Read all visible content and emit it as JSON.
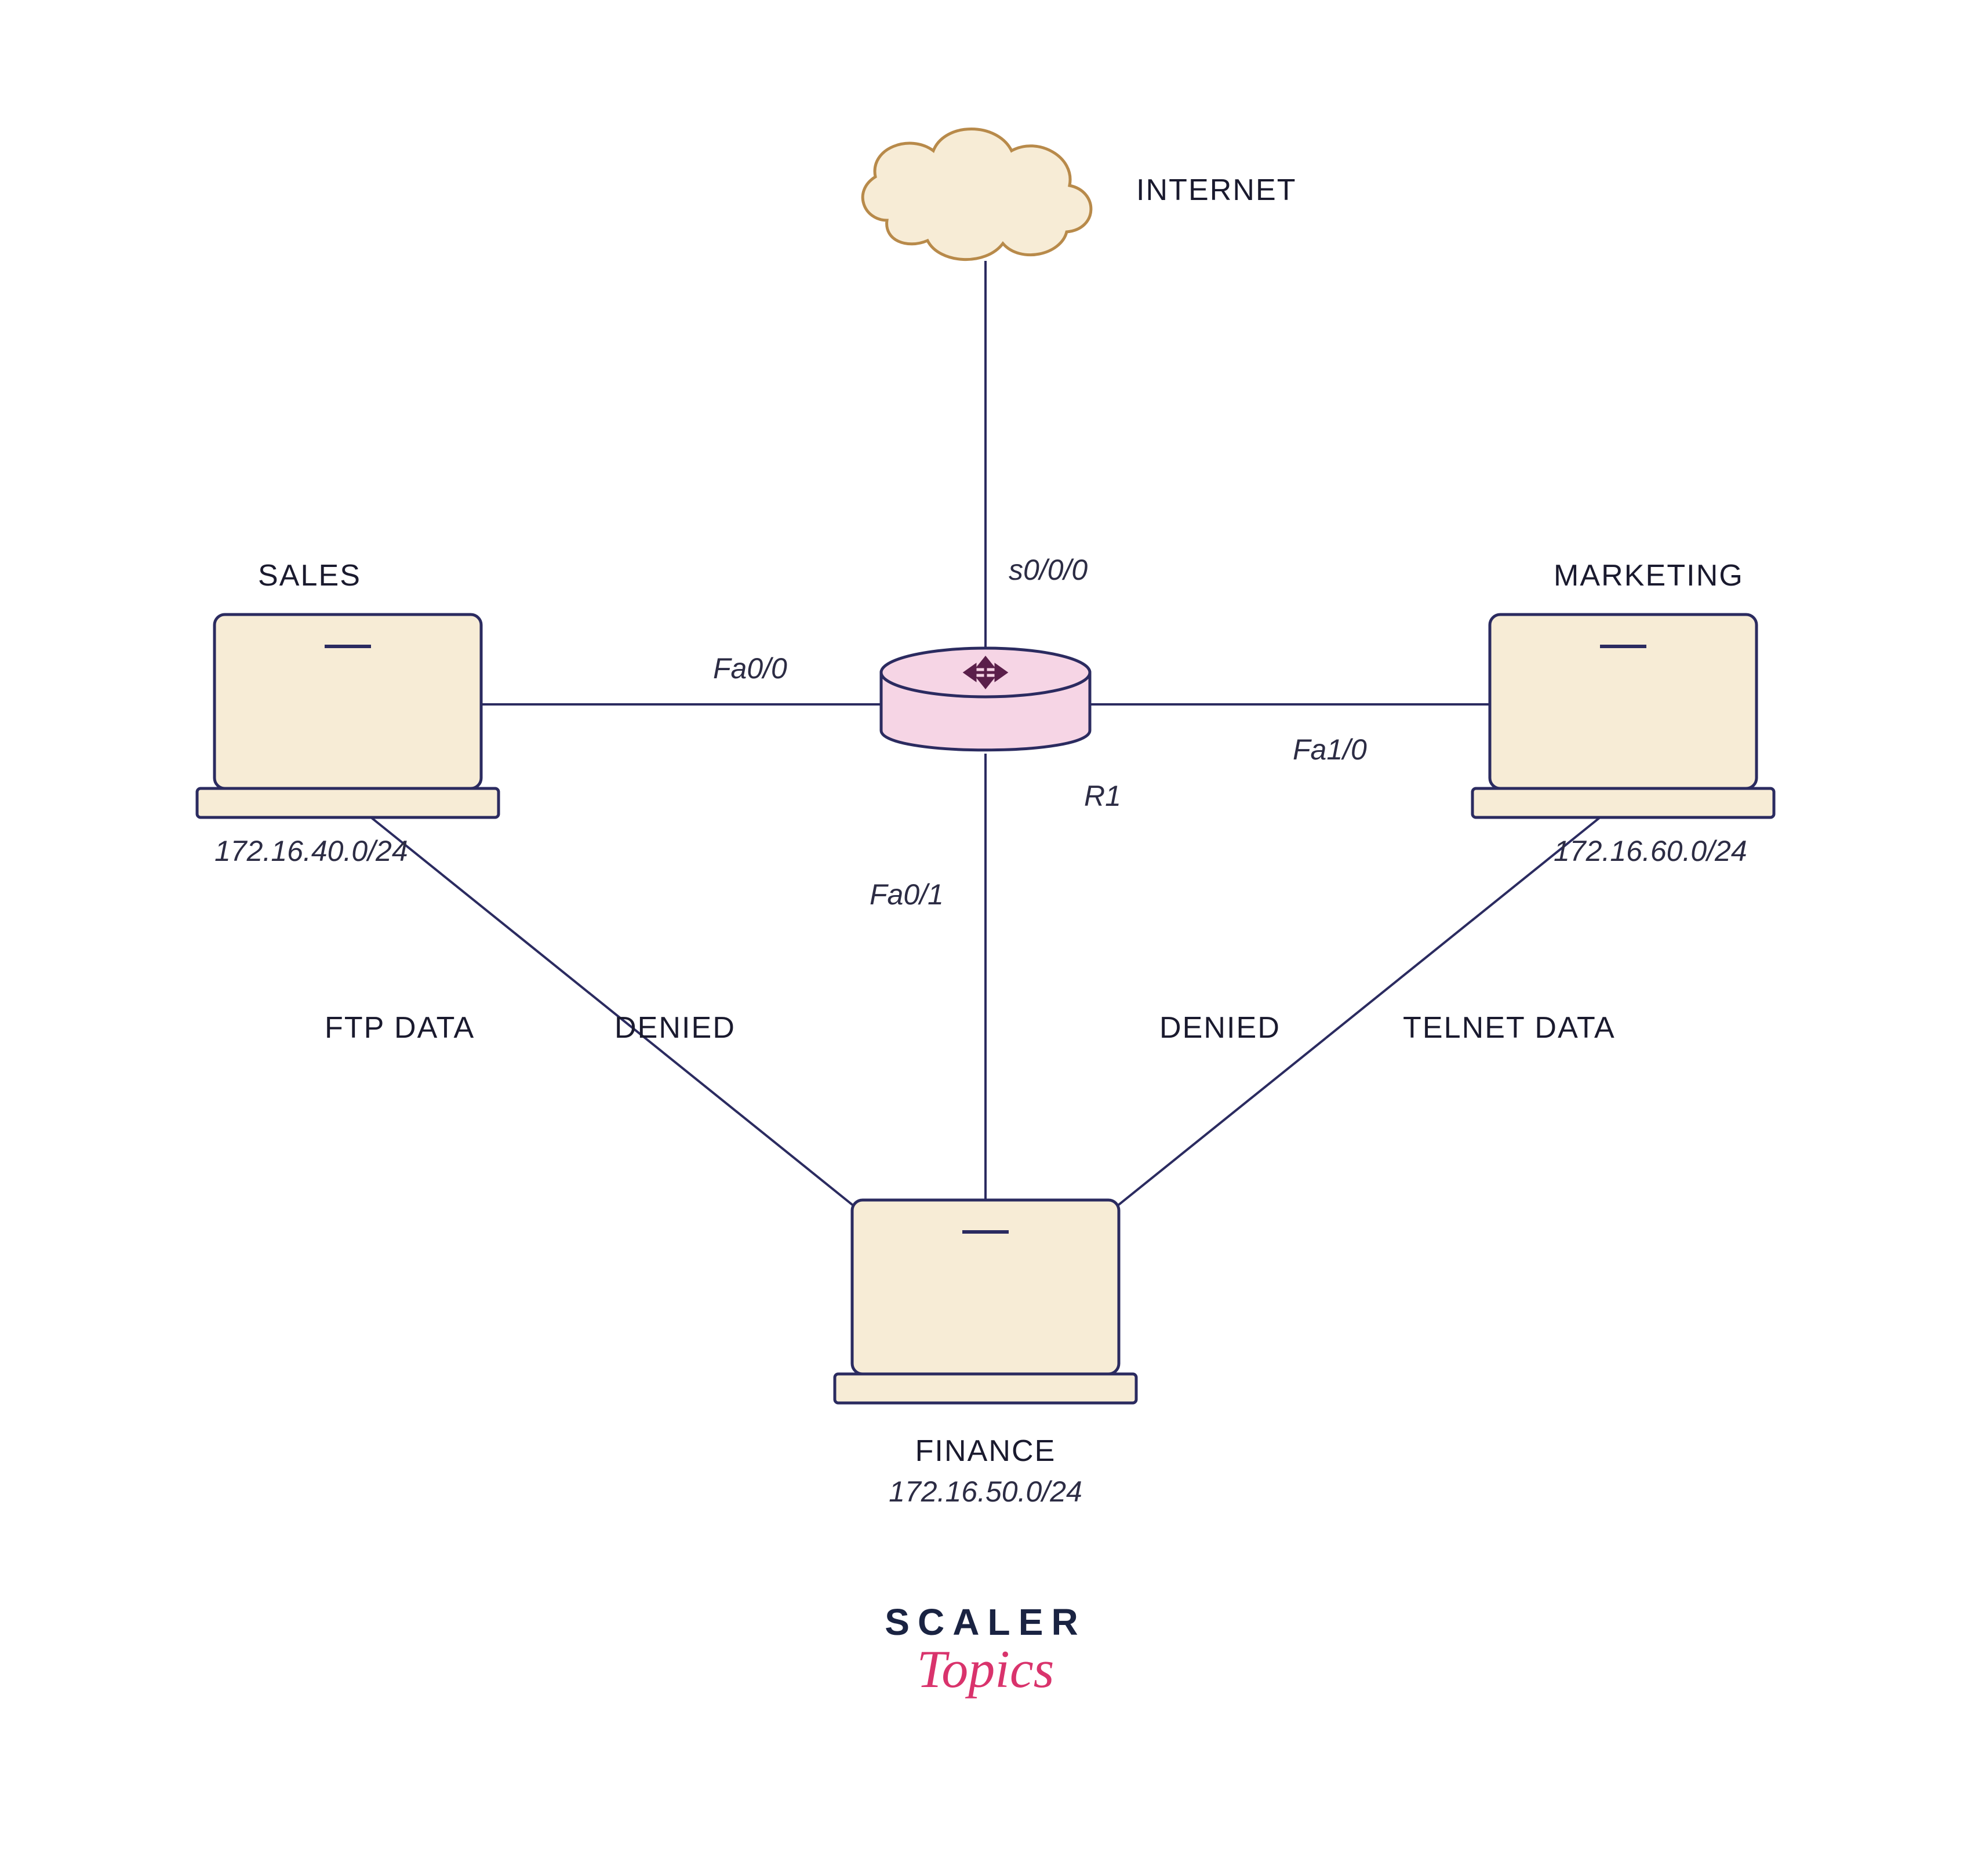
{
  "colors": {
    "laptopFill": "#f7ecd6",
    "laptopStroke": "#2b2b60",
    "routerFill": "#f6d5e5",
    "routerStroke": "#2b2b60",
    "cloudFill": "#f7ecd6",
    "cloudStroke": "#b88a4a",
    "line": "#2b2b60",
    "arrowFill": "#5a1f4a",
    "text": "#1a1a2e"
  },
  "nodes": {
    "internet": {
      "label": "INTERNET"
    },
    "router": {
      "name": "R1",
      "if_top": "s0/0/0",
      "if_left": "Fa0/0",
      "if_right": "Fa1/0",
      "if_bottom": "Fa0/1"
    },
    "sales": {
      "label": "SALES",
      "subnet": "172.16.40.0/24"
    },
    "marketing": {
      "label": "MARKETING",
      "subnet": "172.16.60.0/24"
    },
    "finance": {
      "label": "FINANCE",
      "subnet": "172.16.50.0/24"
    }
  },
  "flows": {
    "left": {
      "traffic": "FTP DATA",
      "status": "DENIED"
    },
    "right": {
      "traffic": "TELNET DATA",
      "status": "DENIED"
    }
  },
  "brand": {
    "line1": "SCALER",
    "line2": "Topics"
  }
}
